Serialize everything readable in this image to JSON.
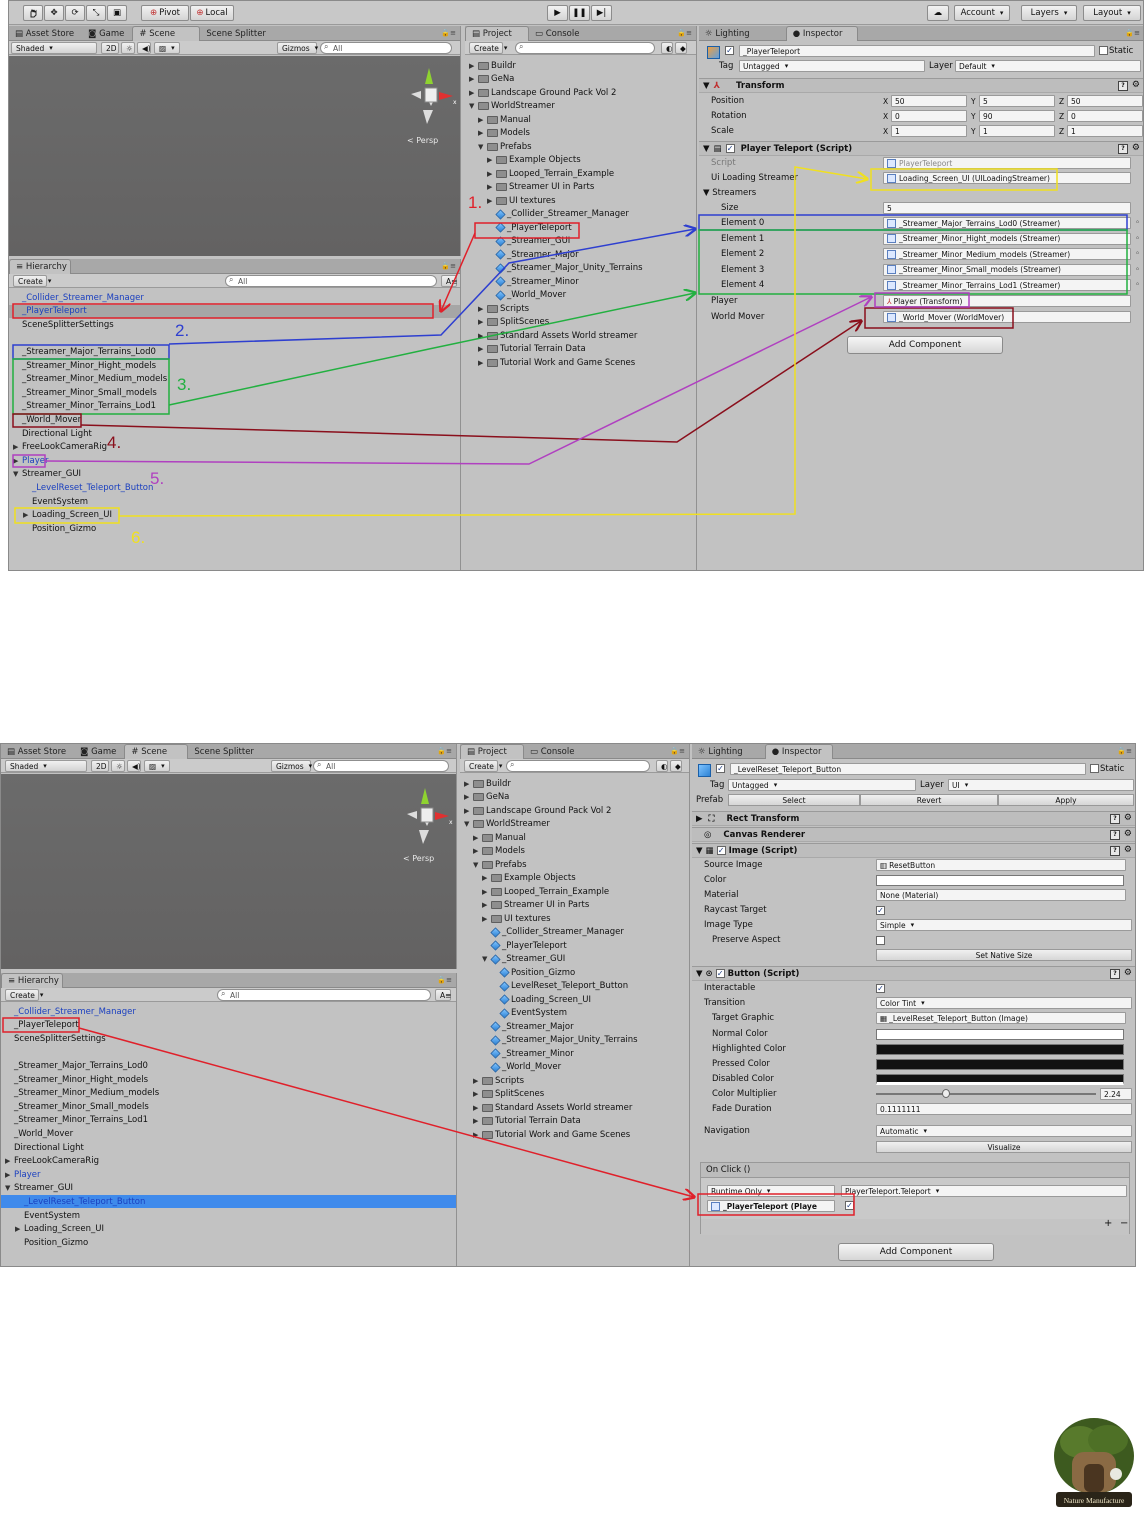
{
  "toolbar": {
    "pivot": "Pivot",
    "local": "Local",
    "account": "Account",
    "layers": "Layers",
    "layout": "Layout"
  },
  "shot1": {
    "scene_tabs": [
      "Asset Store",
      "Game",
      "Scene",
      "Scene Splitter"
    ],
    "shading": "Shaded",
    "mode2d": "2D",
    "gizmos": "Gizmos",
    "search_all": "All",
    "persp": "Persp",
    "hierarchy_tab": "Hierarchy",
    "create": "Create",
    "hierarchy": [
      {
        "label": "_Collider_Streamer_Manager",
        "blue": true,
        "arrow": false
      },
      {
        "label": "_PlayerTeleport",
        "blue": true,
        "arrow": false,
        "gray": true
      },
      {
        "label": "SceneSplitterSettings",
        "blue": false,
        "arrow": false
      },
      {
        "label": "",
        "blue": false,
        "arrow": false
      },
      {
        "label": "_Streamer_Major_Terrains_Lod0",
        "blue": false,
        "arrow": false
      },
      {
        "label": "_Streamer_Minor_Hight_models",
        "blue": false,
        "arrow": false
      },
      {
        "label": "_Streamer_Minor_Medium_models",
        "blue": false,
        "arrow": false
      },
      {
        "label": "_Streamer_Minor_Small_models",
        "blue": false,
        "arrow": false
      },
      {
        "label": "_Streamer_Minor_Terrains_Lod1",
        "blue": false,
        "arrow": false
      },
      {
        "label": "_World_Mover",
        "blue": false,
        "arrow": false
      },
      {
        "label": "Directional Light",
        "blue": false,
        "arrow": false
      },
      {
        "label": "FreeLookCameraRig",
        "blue": false,
        "arrow": true
      },
      {
        "label": "Player",
        "blue": true,
        "arrow": true
      },
      {
        "label": "Streamer_GUI",
        "blue": false,
        "arrow": true,
        "open": true
      },
      {
        "label": "_LevelReset_Teleport_Button",
        "blue": true,
        "arrow": false,
        "indent": true
      },
      {
        "label": "EventSystem",
        "blue": false,
        "arrow": false,
        "indent": true
      },
      {
        "label": "Loading_Screen_UI",
        "blue": false,
        "arrow": true,
        "indent": true
      },
      {
        "label": "Position_Gizmo",
        "blue": false,
        "arrow": false,
        "indent": true
      }
    ],
    "project_tabs": [
      "Project",
      "Console"
    ],
    "project": [
      {
        "label": "Buildr",
        "d": 0,
        "type": "folder"
      },
      {
        "label": "GeNa",
        "d": 0,
        "type": "folder"
      },
      {
        "label": "Landscape Ground Pack  Vol 2",
        "d": 0,
        "type": "folder"
      },
      {
        "label": "WorldStreamer",
        "d": 0,
        "type": "folder",
        "open": true
      },
      {
        "label": "Manual",
        "d": 1,
        "type": "folder"
      },
      {
        "label": "Models",
        "d": 1,
        "type": "folder"
      },
      {
        "label": "Prefabs",
        "d": 1,
        "type": "folder",
        "open": true
      },
      {
        "label": "Example Objects",
        "d": 2,
        "type": "folder"
      },
      {
        "label": "Looped_Terrain_Example",
        "d": 2,
        "type": "folder"
      },
      {
        "label": "Streamer UI in Parts",
        "d": 2,
        "type": "folder"
      },
      {
        "label": "UI textures",
        "d": 2,
        "type": "folder"
      },
      {
        "label": "_Collider_Streamer_Manager",
        "d": 2,
        "type": "prefab"
      },
      {
        "label": "_PlayerTeleport",
        "d": 2,
        "type": "prefab"
      },
      {
        "label": "_Streamer_GUI",
        "d": 2,
        "type": "prefab"
      },
      {
        "label": "_Streamer_Major",
        "d": 2,
        "type": "prefab"
      },
      {
        "label": "_Streamer_Major_Unity_Terrains",
        "d": 2,
        "type": "prefab"
      },
      {
        "label": "_Streamer_Minor",
        "d": 2,
        "type": "prefab"
      },
      {
        "label": "_World_Mover",
        "d": 2,
        "type": "prefab"
      },
      {
        "label": "Scripts",
        "d": 1,
        "type": "folder"
      },
      {
        "label": "SplitScenes",
        "d": 1,
        "type": "folder"
      },
      {
        "label": "Standard Assets World streamer",
        "d": 1,
        "type": "folder"
      },
      {
        "label": "Tutorial Terrain Data",
        "d": 1,
        "type": "folder"
      },
      {
        "label": "Tutorial Work and Game Scenes",
        "d": 1,
        "type": "folder"
      }
    ],
    "inspector_tabs": [
      "Lighting",
      "Inspector"
    ],
    "object_name": "_PlayerTeleport",
    "static": "Static",
    "tag_label": "Tag",
    "tag_value": "Untagged",
    "layer_label": "Layer",
    "layer_value": "Default",
    "transform": {
      "title": "Transform",
      "position": {
        "label": "Position",
        "x": "50",
        "y": "5",
        "z": "50"
      },
      "rotation": {
        "label": "Rotation",
        "x": "0",
        "y": "90",
        "z": "0"
      },
      "scale": {
        "label": "Scale",
        "x": "1",
        "y": "1",
        "z": "1"
      }
    },
    "script": {
      "title": "Player Teleport (Script)",
      "script_label": "Script",
      "script_value": "PlayerTeleport",
      "ui_label": "Ui Loading Streamer",
      "ui_value": "Loading_Screen_UI (UILoadingStreamer)",
      "streamers_label": "Streamers",
      "size_label": "Size",
      "size_value": "5",
      "elements": [
        {
          "label": "Element 0",
          "value": "_Streamer_Major_Terrains_Lod0 (Streamer)"
        },
        {
          "label": "Element 1",
          "value": "_Streamer_Minor_Hight_models (Streamer)"
        },
        {
          "label": "Element 2",
          "value": "_Streamer_Minor_Medium_models (Streamer)"
        },
        {
          "label": "Element 3",
          "value": "_Streamer_Minor_Small_models (Streamer)"
        },
        {
          "label": "Element 4",
          "value": "_Streamer_Minor_Terrains_Lod1 (Streamer)"
        }
      ],
      "player_label": "Player",
      "player_value": "Player (Transform)",
      "mover_label": "World Mover",
      "mover_value": "_World_Mover (WorldMover)"
    },
    "add_component": "Add Component",
    "annotations": [
      "1.",
      "2.",
      "3.",
      "4.",
      "5.",
      "6."
    ],
    "annotation_colors": [
      "#e0202a",
      "#2e3fd0",
      "#22b040",
      "#8a0f1c",
      "#b040c0",
      "#f0e020"
    ]
  },
  "shot2": {
    "scene_tabs": [
      "Asset Store",
      "Game",
      "Scene",
      "Scene Splitter"
    ],
    "shading": "Shaded",
    "mode2d": "2D",
    "gizmos": "Gizmos",
    "search_all": "All",
    "persp": "Persp",
    "hierarchy_tab": "Hierarchy",
    "create": "Create",
    "hierarchy": [
      {
        "label": "_Collider_Streamer_Manager",
        "blue": true,
        "arrow": false
      },
      {
        "label": "_PlayerTeleport",
        "blue": false,
        "arrow": false
      },
      {
        "label": "SceneSplitterSettings",
        "blue": false,
        "arrow": false
      },
      {
        "label": "",
        "blue": false,
        "arrow": false
      },
      {
        "label": "_Streamer_Major_Terrains_Lod0",
        "blue": false,
        "arrow": false
      },
      {
        "label": "_Streamer_Minor_Hight_models",
        "blue": false,
        "arrow": false
      },
      {
        "label": "_Streamer_Minor_Medium_models",
        "blue": false,
        "arrow": false
      },
      {
        "label": "_Streamer_Minor_Small_models",
        "blue": false,
        "arrow": false
      },
      {
        "label": "_Streamer_Minor_Terrains_Lod1",
        "blue": false,
        "arrow": false
      },
      {
        "label": "_World_Mover",
        "blue": false,
        "arrow": false
      },
      {
        "label": "Directional Light",
        "blue": false,
        "arrow": false
      },
      {
        "label": "FreeLookCameraRig",
        "blue": false,
        "arrow": true
      },
      {
        "label": "Player",
        "blue": true,
        "arrow": true
      },
      {
        "label": "Streamer_GUI",
        "blue": false,
        "arrow": true,
        "open": true
      },
      {
        "label": "_LevelReset_Teleport_Button",
        "blue": true,
        "arrow": false,
        "indent": true,
        "sel": true
      },
      {
        "label": "EventSystem",
        "blue": false,
        "arrow": false,
        "indent": true
      },
      {
        "label": "Loading_Screen_UI",
        "blue": false,
        "arrow": true,
        "indent": true
      },
      {
        "label": "Position_Gizmo",
        "blue": false,
        "arrow": false,
        "indent": true
      }
    ],
    "project_tabs": [
      "Project",
      "Console"
    ],
    "project": [
      {
        "label": "Buildr",
        "d": 0,
        "type": "folder"
      },
      {
        "label": "GeNa",
        "d": 0,
        "type": "folder"
      },
      {
        "label": "Landscape Ground Pack  Vol 2",
        "d": 0,
        "type": "folder"
      },
      {
        "label": "WorldStreamer",
        "d": 0,
        "type": "folder",
        "open": true
      },
      {
        "label": "Manual",
        "d": 1,
        "type": "folder"
      },
      {
        "label": "Models",
        "d": 1,
        "type": "folder"
      },
      {
        "label": "Prefabs",
        "d": 1,
        "type": "folder",
        "open": true
      },
      {
        "label": "Example Objects",
        "d": 2,
        "type": "folder"
      },
      {
        "label": "Looped_Terrain_Example",
        "d": 2,
        "type": "folder"
      },
      {
        "label": "Streamer UI in Parts",
        "d": 2,
        "type": "folder"
      },
      {
        "label": "UI textures",
        "d": 2,
        "type": "folder"
      },
      {
        "label": "_Collider_Streamer_Manager",
        "d": 2,
        "type": "prefab"
      },
      {
        "label": "_PlayerTeleport",
        "d": 2,
        "type": "prefab"
      },
      {
        "label": "_Streamer_GUI",
        "d": 2,
        "type": "prefab",
        "open": true
      },
      {
        "label": "Position_Gizmo",
        "d": 3,
        "type": "prefab"
      },
      {
        "label": "LevelReset_Teleport_Button",
        "d": 3,
        "type": "prefab"
      },
      {
        "label": "Loading_Screen_UI",
        "d": 3,
        "type": "prefab"
      },
      {
        "label": "EventSystem",
        "d": 3,
        "type": "prefab"
      },
      {
        "label": "_Streamer_Major",
        "d": 2,
        "type": "prefab"
      },
      {
        "label": "_Streamer_Major_Unity_Terrains",
        "d": 2,
        "type": "prefab"
      },
      {
        "label": "_Streamer_Minor",
        "d": 2,
        "type": "prefab"
      },
      {
        "label": "_World_Mover",
        "d": 2,
        "type": "prefab"
      },
      {
        "label": "Scripts",
        "d": 1,
        "type": "folder"
      },
      {
        "label": "SplitScenes",
        "d": 1,
        "type": "folder"
      },
      {
        "label": "Standard Assets World streamer",
        "d": 1,
        "type": "folder"
      },
      {
        "label": "Tutorial Terrain Data",
        "d": 1,
        "type": "folder"
      },
      {
        "label": "Tutorial Work and Game Scenes",
        "d": 1,
        "type": "folder"
      }
    ],
    "inspector_tabs": [
      "Lighting",
      "Inspector"
    ],
    "object_name": "_LevelReset_Teleport_Button",
    "static": "Static",
    "tag_label": "Tag",
    "tag_value": "Untagged",
    "layer_label": "Layer",
    "layer_value": "UI",
    "prefab_label": "Prefab",
    "prefab_select": "Select",
    "prefab_revert": "Revert",
    "prefab_apply": "Apply",
    "rect_transform": "Rect Transform",
    "canvas_renderer": "Canvas Renderer",
    "image": {
      "title": "Image (Script)",
      "source_label": "Source Image",
      "source_value": "ResetButton",
      "color_label": "Color",
      "material_label": "Material",
      "material_value": "None (Material)",
      "raycast_label": "Raycast Target",
      "type_label": "Image Type",
      "type_value": "Simple",
      "preserve_label": "Preserve Aspect",
      "native_size": "Set Native Size"
    },
    "button": {
      "title": "Button (Script)",
      "interactable_label": "Interactable",
      "transition_label": "Transition",
      "transition_value": "Color Tint",
      "target_label": "Target Graphic",
      "target_value": "_LevelReset_Teleport_Button (Image)",
      "normal_label": "Normal Color",
      "highlighted_label": "Highlighted Color",
      "pressed_label": "Pressed Color",
      "disabled_label": "Disabled Color",
      "multiplier_label": "Color Multiplier",
      "multiplier_value": "2.24",
      "fade_label": "Fade Duration",
      "fade_value": "0.1111111",
      "navigation_label": "Navigation",
      "navigation_value": "Automatic",
      "visualize": "Visualize",
      "onclick": "On Click ()",
      "runtime": "Runtime Only",
      "function": "PlayerTeleport.Teleport",
      "target_obj": "_PlayerTeleport (Playe"
    },
    "add_component": "Add Component"
  },
  "logo": {
    "text": "Nature Manufacture"
  }
}
